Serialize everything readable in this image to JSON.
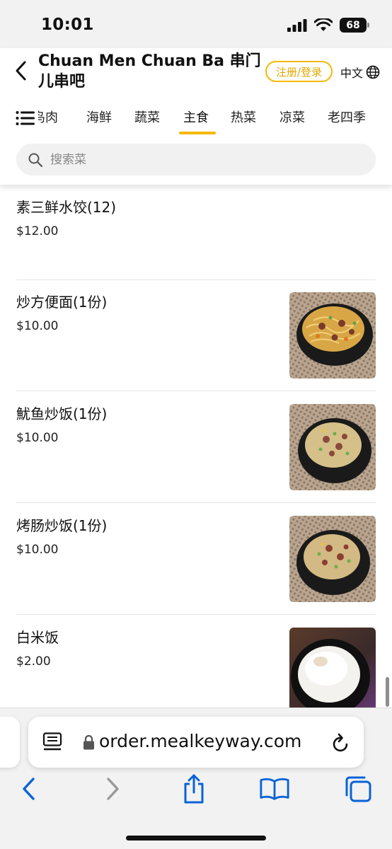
{
  "status_bar": {
    "time": "10:01",
    "battery": "68"
  },
  "header": {
    "restaurant_name": "Chuan Men Chuan Ba 串门儿串吧",
    "login_label": "注册/登录",
    "language_label": "中文",
    "categories": [
      {
        "label": "鸟肉",
        "active": false
      },
      {
        "label": "海鲜",
        "active": false
      },
      {
        "label": "蔬菜",
        "active": false
      },
      {
        "label": "主食",
        "active": true
      },
      {
        "label": "热菜",
        "active": false
      },
      {
        "label": "凉菜",
        "active": false
      },
      {
        "label": "老四季",
        "active": false
      }
    ],
    "search_placeholder": "搜索菜"
  },
  "menu_items": [
    {
      "name": "素三鲜水饺(12)",
      "price": "$12.00",
      "photo": null
    },
    {
      "name": "炒方便面(1份)",
      "price": "$10.00",
      "photo": "noodles"
    },
    {
      "name": "魷鱼炒饭(1份)",
      "price": "$10.00",
      "photo": "fried-rice"
    },
    {
      "name": "烤肠炒饭(1份)",
      "price": "$10.00",
      "photo": "fried-rice"
    },
    {
      "name": "白米饭",
      "price": "$2.00",
      "photo": "white-rice"
    }
  ],
  "browser": {
    "url": "order.mealkeyway.com"
  },
  "colors": {
    "accent": "#f5b800",
    "safari_blue": "#0a63d6"
  }
}
